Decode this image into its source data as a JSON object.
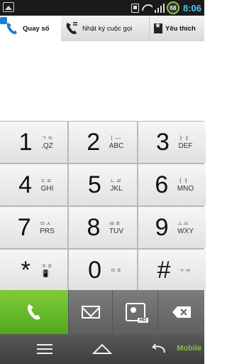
{
  "status_bar": {
    "time": "8:06",
    "battery_level": "68",
    "icons": [
      "image-icon",
      "sim-icon",
      "wifi-icon",
      "signal-icon",
      "battery-icon"
    ]
  },
  "tabs": [
    {
      "label": "Quay số",
      "icon": "phone-icon",
      "selected": true
    },
    {
      "label": "Nhật ký cuộc gọi",
      "icon": "call-log-icon",
      "selected": false
    },
    {
      "label": "Yêu thích",
      "icon": "star-icon",
      "selected": false
    }
  ],
  "keypad": [
    {
      "digit": "1",
      "kor": "ㄱㅋ",
      "lat": ".QZ"
    },
    {
      "digit": "2",
      "kor": "ㅣ—",
      "lat": "ABC"
    },
    {
      "digit": "3",
      "kor": "ㅏㅑ",
      "lat": "DEF"
    },
    {
      "digit": "4",
      "kor": "ㄷㅌ",
      "lat": "GHI"
    },
    {
      "digit": "5",
      "kor": "ㄴㄹ",
      "lat": "JKL"
    },
    {
      "digit": "6",
      "kor": "ㅓㅕ",
      "lat": "MNO"
    },
    {
      "digit": "7",
      "kor": "ㅁㅅ",
      "lat": "PRS"
    },
    {
      "digit": "8",
      "kor": "ㅂㅍ",
      "lat": "TUV"
    },
    {
      "digit": "9",
      "kor": "ㅗㅛ",
      "lat": "WXY"
    },
    {
      "digit": "*",
      "kor": "ㅈㅊ",
      "lat": "📳"
    },
    {
      "digit": "0",
      "kor": "ㅇㅎ",
      "lat": ""
    },
    {
      "digit": "#",
      "kor": "ㅜㅠ",
      "lat": ""
    }
  ],
  "actions": {
    "call": "call-icon",
    "message": "envelope-icon",
    "video_call": "HD",
    "delete": "backspace-icon"
  },
  "watermark": "Mobile",
  "colors": {
    "accent": "#1b7fd6",
    "call_green": "#6cbf2c",
    "clock_blue": "#4fc3f7"
  }
}
